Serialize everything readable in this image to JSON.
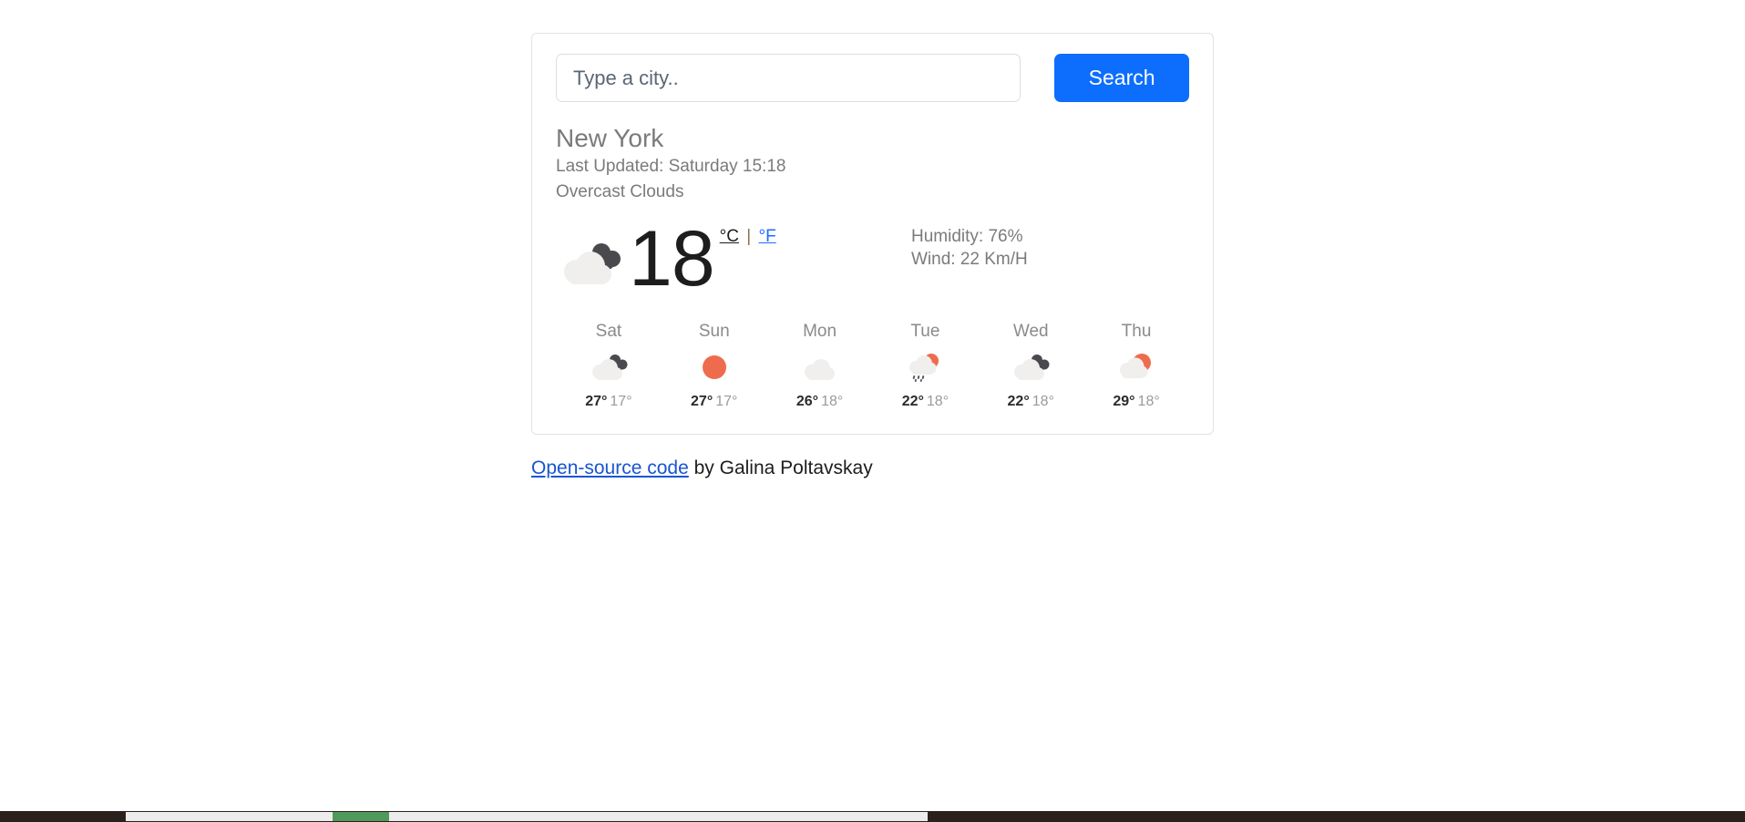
{
  "search": {
    "placeholder": "Type a city..",
    "value": "",
    "button_label": "Search"
  },
  "current": {
    "city": "New York",
    "last_updated": "Last Updated: Saturday 15:18",
    "description": "Overcast Clouds",
    "temperature": "18",
    "icon": "overcast-clouds-icon",
    "unit_celsius": "°C",
    "unit_separator": "|",
    "unit_fahrenheit": "°F",
    "active_unit": "celsius",
    "humidity": "Humidity: 76%",
    "wind": "Wind: 22 Km/H"
  },
  "forecast": [
    {
      "day": "Sat",
      "icon": "overcast-clouds-icon",
      "max": "27°",
      "min": "17°"
    },
    {
      "day": "Sun",
      "icon": "clear-sun-icon",
      "max": "27°",
      "min": "17°"
    },
    {
      "day": "Mon",
      "icon": "cloud-icon",
      "max": "26°",
      "min": "18°"
    },
    {
      "day": "Tue",
      "icon": "sun-rain-cloud-icon",
      "max": "22°",
      "min": "18°"
    },
    {
      "day": "Wed",
      "icon": "overcast-clouds-icon",
      "max": "22°",
      "min": "18°"
    },
    {
      "day": "Thu",
      "icon": "sun-behind-cloud-icon",
      "max": "29°",
      "min": "18°"
    }
  ],
  "footer": {
    "link_label": "Open-source code",
    "author_text": " by Galina Poltavskay"
  },
  "colors": {
    "accent_blue": "#0d6efd",
    "link_blue": "#1755d1",
    "sun_orange": "#ee6c4d",
    "cloud_light": "#f0efed",
    "cloud_dark": "#4a4a4e",
    "muted_text": "#7b7b7b"
  }
}
